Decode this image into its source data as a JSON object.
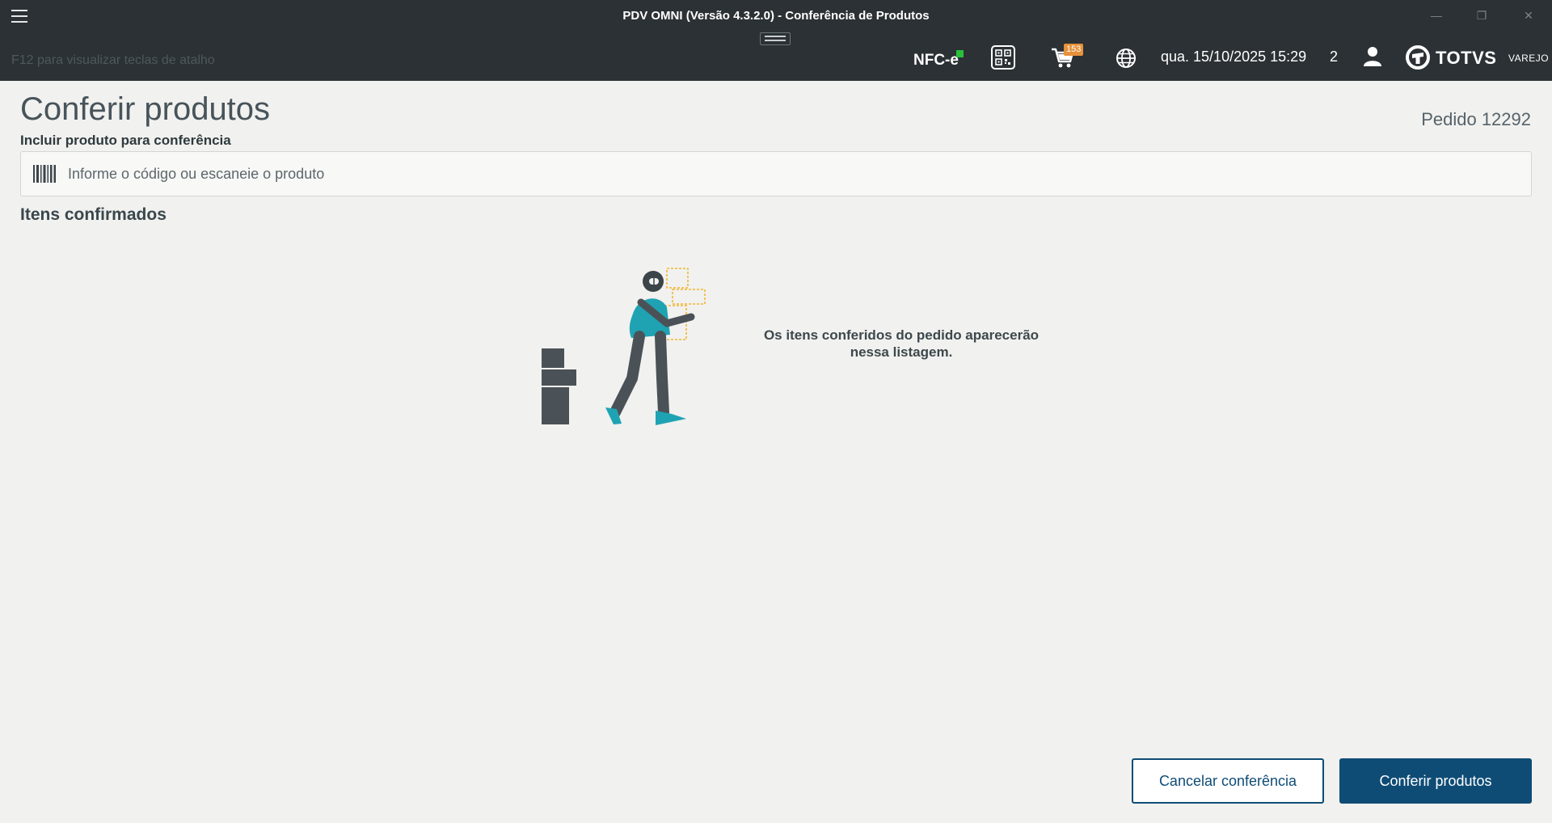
{
  "window": {
    "title": "PDV OMNI (Versão 4.3.2.0) - Conferência de Produtos",
    "minimize": "—",
    "restore": "❐",
    "close": "✕"
  },
  "toolbar": {
    "shortcut_hint": "F12 para visualizar teclas de atalho",
    "nfce_label": "NFC-e",
    "cart_badge": "153",
    "datetime": "qua. 15/10/2025 15:29",
    "user_count": "2",
    "brand_name": "TOTVS",
    "brand_sub": "VAREJO",
    "colors": {
      "bar": "#2b3134",
      "status_ok": "#28c03a",
      "badge": "#e8913a"
    }
  },
  "page": {
    "title": "Conferir produtos",
    "order_label": "Pedido 12292",
    "include_label": "Incluir produto para conferência",
    "search_placeholder": "Informe o código ou escaneie o produto",
    "confirmed_title": "Itens confirmados",
    "empty_message": "Os itens conferidos do pedido aparecerão nessa listagem."
  },
  "actions": {
    "cancel_label": "Cancelar conferência",
    "confirm_label": "Conferir produtos",
    "accent": "#0f4c75"
  }
}
